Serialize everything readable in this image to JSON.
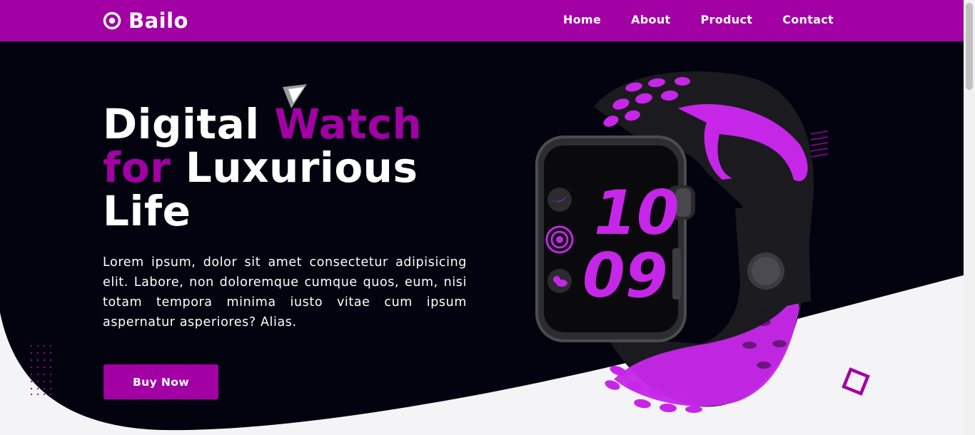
{
  "brand": {
    "name": "Bailo",
    "icon": "target-icon"
  },
  "nav": {
    "items": [
      {
        "label": "Home"
      },
      {
        "label": "About"
      },
      {
        "label": "Product"
      },
      {
        "label": "Contact"
      }
    ]
  },
  "hero": {
    "title_part1": "Digital ",
    "title_accent1": "Watch",
    "title_accent2": "for",
    "title_part2": " Luxurious",
    "title_part3": "Life",
    "description": "Lorem ipsum, dolor sit amet consectetur adipisicing elit. Labore, non doloremque cumque quos, eum, nisi totam tempora minima iusto vitae cum ipsum aspernatur asperiores? Alias.",
    "cta_label": "Buy Now"
  },
  "watch": {
    "hour": "10",
    "minute": "09"
  },
  "colors": {
    "brand_purple": "#a200a4",
    "hero_dark": "#03020f",
    "page_light": "#f4f4f6",
    "watch_band_accent": "#c626e8"
  }
}
